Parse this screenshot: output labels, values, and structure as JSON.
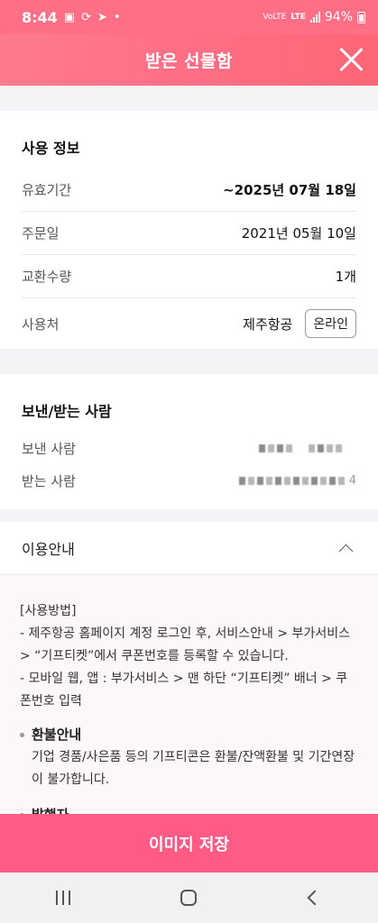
{
  "status_bar": {
    "time": "8:44",
    "battery": "94%",
    "network": "LTE",
    "carrier_tag": "VoLTE"
  },
  "header": {
    "title": "받은 선물함"
  },
  "usage_info": {
    "title": "사용 정보",
    "rows": [
      {
        "label": "유효기간",
        "value": "~2025년 07월 18일"
      },
      {
        "label": "주문일",
        "value": "2021년 05월 10일"
      },
      {
        "label": "교환수량",
        "value": "1개"
      },
      {
        "label": "사용처",
        "value": "제주항공"
      }
    ],
    "online_button": "온라인"
  },
  "sender_receiver": {
    "title": "보낸/받는 사람",
    "sender_label": "보낸 사람",
    "receiver_label": "받는 사람",
    "receiver_suffix": "4"
  },
  "guide": {
    "title": "이용안내",
    "method_header": "[사용방법]",
    "method_line1": "- 제주항공 홈페이지 계정 로그인 후, 서비스안내 > 부가서비스 > “기프티켓”에서 쿠폰번호를 등록할 수 있습니다.",
    "method_line2": "- 모바일 웹, 앱 : 부가서비스 > 맨 하단 “기프티켓” 배너 > 쿠폰번호 입력",
    "refund_title": "환불안내",
    "refund_text": "기업 경품/사은품 등의 기프티콘은 환불/잔액환불 및 기간연장이 불가합니다.",
    "issuer_title": "발행자"
  },
  "save_button": "이미지 저장",
  "colors": {
    "header": "#ff6f86",
    "save_button": "#ff5b85"
  }
}
